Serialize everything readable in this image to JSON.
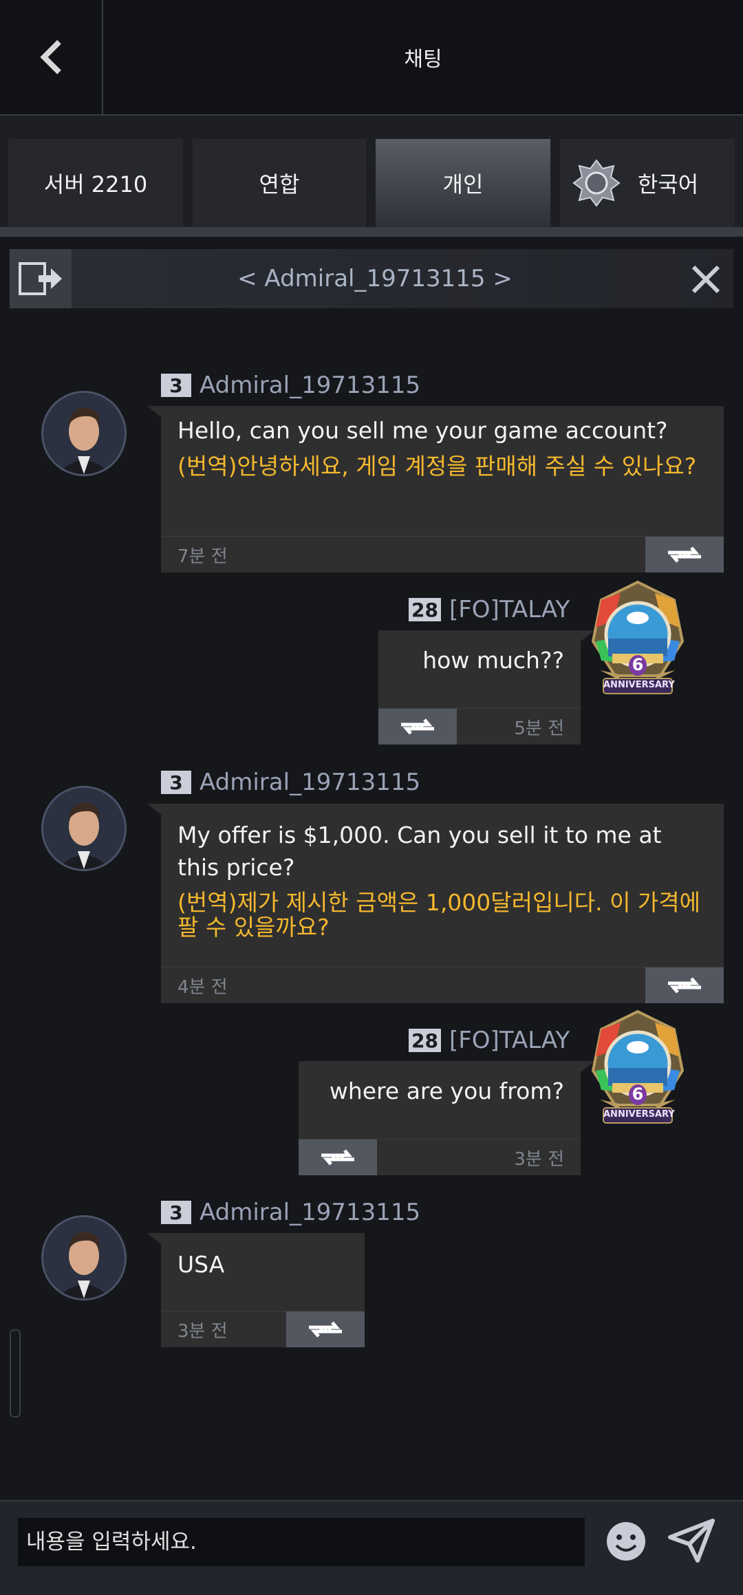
{
  "header": {
    "title": "채팅"
  },
  "tabs": [
    {
      "label": "서버 2210"
    },
    {
      "label": "연합"
    },
    {
      "label": "개인"
    },
    {
      "label": "한국어"
    }
  ],
  "dm": {
    "title": "< Admiral_19713115 >"
  },
  "messages": [
    {
      "level": "3",
      "name": "Admiral_19713115",
      "text": "Hello, can you sell me your game account?",
      "translation": "(번역)안녕하세요, 게임 계정을 판매해 주실 수 있나요?",
      "time": "7분 전"
    },
    {
      "level": "28",
      "name": "[FO]TALAY",
      "text": "how much??",
      "time": "5분 전",
      "badge_text": "ANNIVERSARY",
      "badge_number": "6"
    },
    {
      "level": "3",
      "name": "Admiral_19713115",
      "text": "My offer is $1,000. Can you sell it to me at this price?",
      "translation": "(번역)제가 제시한 금액은 1,000달러입니다. 이 가격에 팔 수 있을까요?",
      "time": "4분 전"
    },
    {
      "level": "28",
      "name": "[FO]TALAY",
      "text": "where are you from?",
      "time": "3분 전",
      "badge_text": "ANNIVERSARY",
      "badge_number": "6"
    },
    {
      "level": "3",
      "name": "Admiral_19713115",
      "text": "USA",
      "time": "3분 전"
    }
  ],
  "composer": {
    "placeholder": "내용을 입력하세요."
  },
  "colors": {
    "translation": "#f5b82e",
    "name": "#9aa3b6",
    "bubble": "#2f2f2f"
  }
}
